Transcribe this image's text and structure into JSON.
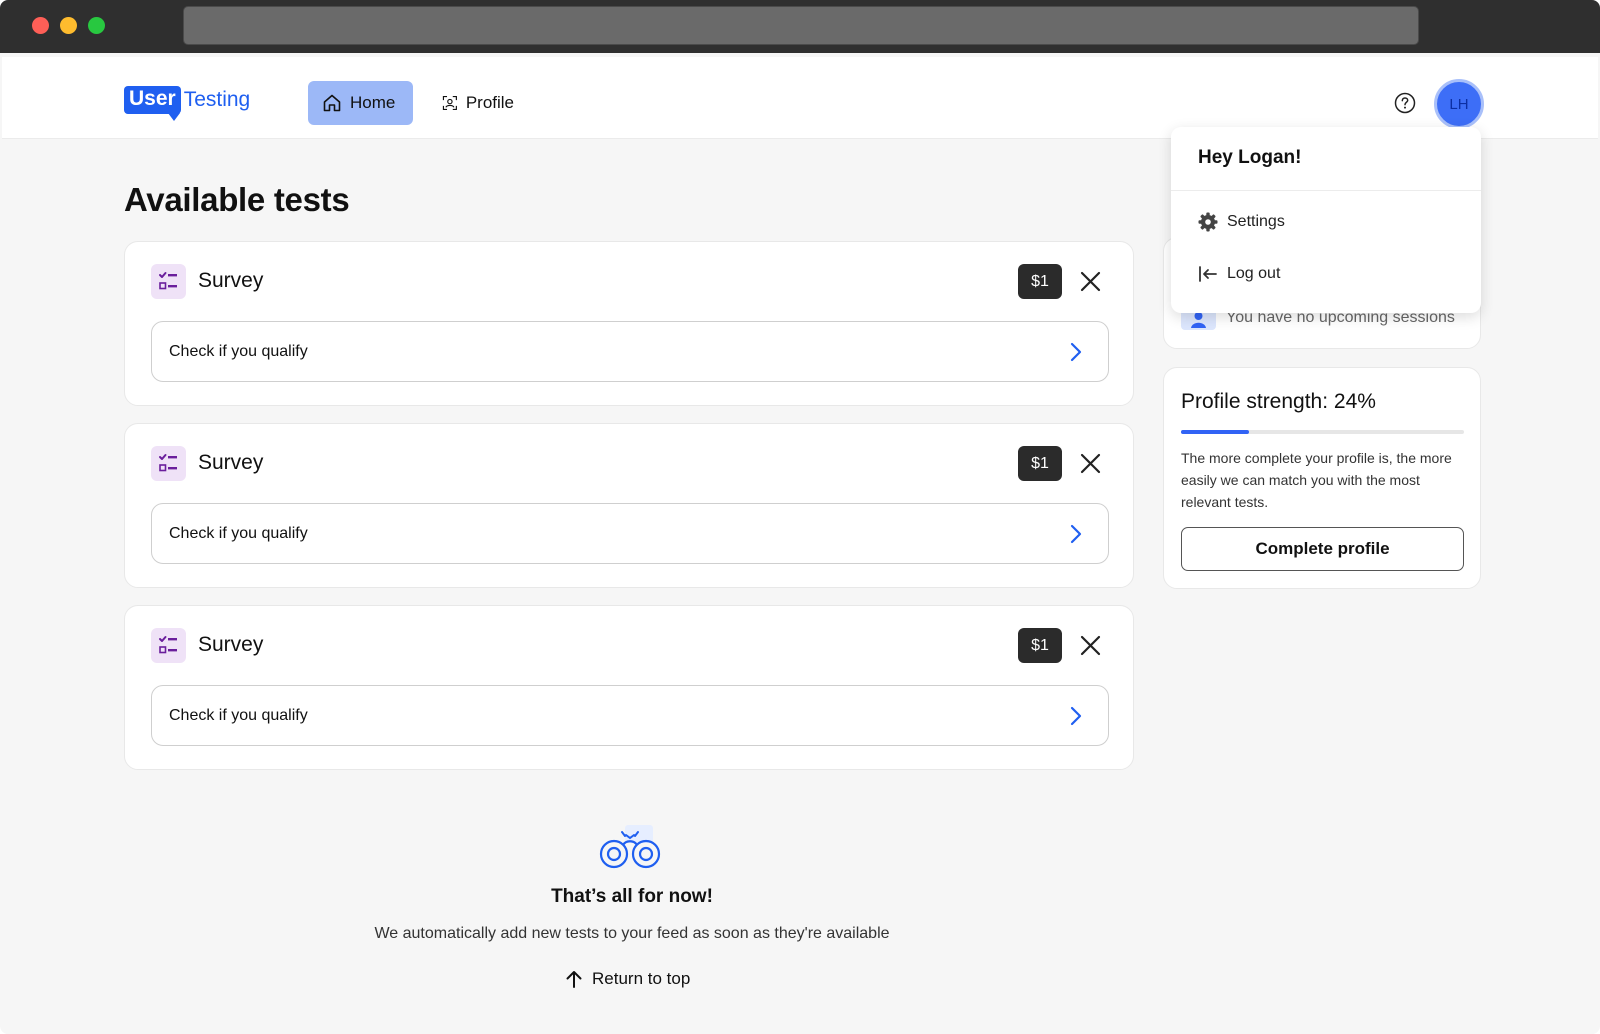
{
  "nav": {
    "logo_user": "User",
    "logo_testing": "Testing",
    "home_label": "Home",
    "profile_label": "Profile",
    "avatar_initials": "LH",
    "accent_color": "#1f5ff0"
  },
  "main": {
    "title": "Available tests",
    "tests": [
      {
        "type": "Survey",
        "price": "$1",
        "action": "Check if you qualify"
      },
      {
        "type": "Survey",
        "price": "$1",
        "action": "Check if you qualify"
      },
      {
        "type": "Survey",
        "price": "$1",
        "action": "Check if you qualify"
      }
    ],
    "empty": {
      "title": "That’s all for now!",
      "description": "We automatically add new tests to your feed as soon as they're available",
      "return_label": "Return to top"
    }
  },
  "sidebar": {
    "sessions_text": "You have no upcoming sessions",
    "profile_strength": {
      "title": "Profile strength: 24%",
      "value_percent": 24,
      "description": "The more complete your profile is, the more easily we can match you with the most relevant tests.",
      "button_label": "Complete profile"
    }
  },
  "account_menu": {
    "greeting": "Hey Logan!",
    "settings_label": "Settings",
    "logout_label": "Log out"
  }
}
